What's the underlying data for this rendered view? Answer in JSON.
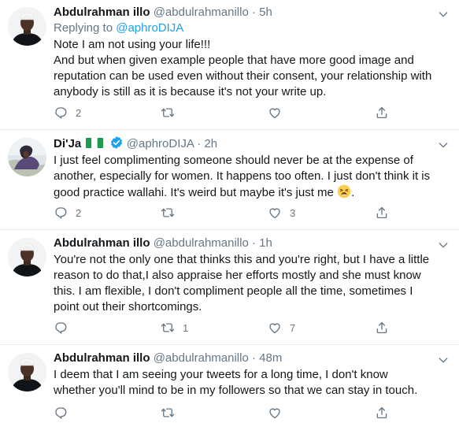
{
  "colors": {
    "accent": "#1da1f2",
    "muted": "#657786",
    "text": "#14171a",
    "divider": "#e6ecf0",
    "verified": "#1da1f2"
  },
  "tweets": [
    {
      "name": "Abdulrahman illo",
      "handle": "@abdulrahmanillo",
      "separator": "·",
      "time": "5h",
      "reply_prefix": "Replying to",
      "reply_to": "@aphroDIJA",
      "lines": [
        "Note I am not using your life!!!",
        "And but when given example people that have more good image and reputation can be used even without their consent, your relationship with anybody is still as it is because it's not your write up."
      ],
      "replies": "2",
      "retweets": "",
      "likes": ""
    },
    {
      "name": "Di'Ja",
      "handle": "@aphroDIJA",
      "separator": "·",
      "time": "2h",
      "flag": "nigeria-flag-icon",
      "text": "I just feel complimenting someone should never be at the expense of another, especially for women.  It happens too often. I just don't think it is good practice wallahi. It's weird but maybe it's just me",
      "text_end": ".",
      "emoji": "tired-face-emoji",
      "replies": "2",
      "retweets": "",
      "likes": "3"
    },
    {
      "name": "Abdulrahman illo",
      "handle": "@abdulrahmanillo",
      "separator": "·",
      "time": "1h",
      "text": "You're not the only one that thinks this and you're right, but I have a little reason to do that,I also appraise her efforts mostly and she must know this. I am flexible, I don't compliment people all the time, sometimes I point out their shortcomings.",
      "replies": "",
      "retweets": "1",
      "likes": "7"
    },
    {
      "name": "Abdulrahman illo",
      "handle": "@abdulrahmanillo",
      "separator": "·",
      "time": "48m",
      "text": "I deem that I am seeing your tweets for a long time, I don't know whether you'll mind to be in my followers so that we can stay in touch.",
      "replies": "",
      "retweets": "",
      "likes": ""
    }
  ],
  "icons": {
    "reply": "reply-icon",
    "retweet": "retweet-icon",
    "like": "heart-icon",
    "share": "share-icon",
    "menu": "chevron-down-icon"
  }
}
